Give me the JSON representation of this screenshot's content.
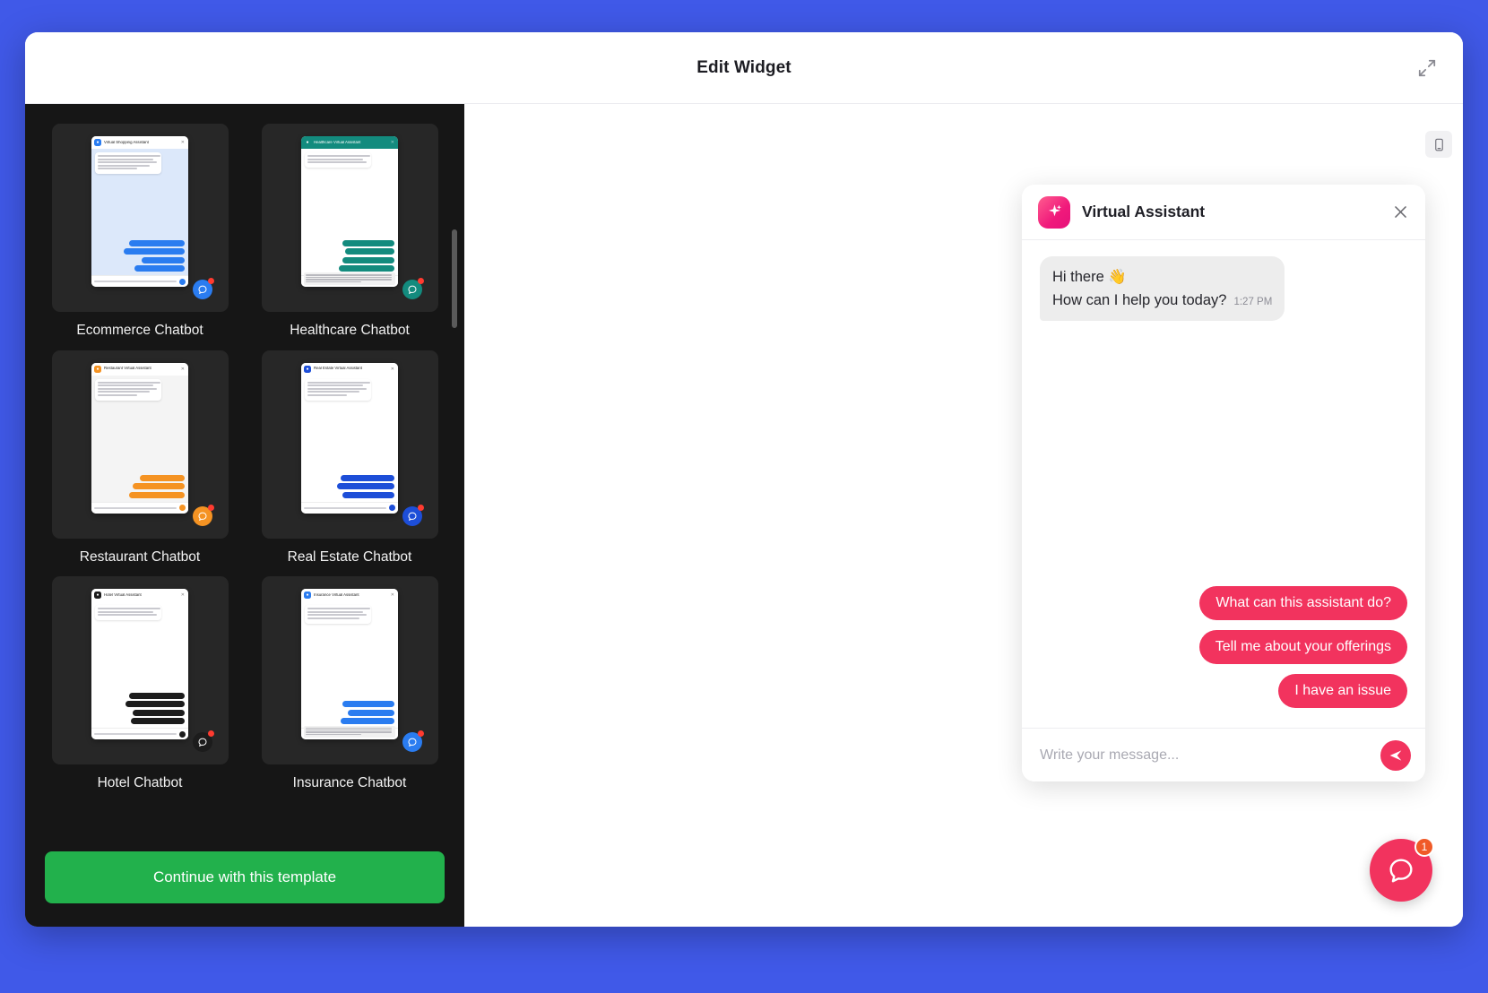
{
  "app": {
    "background_color": "#4059e8",
    "modal_title": "Edit Widget",
    "expand_icon": "expand-arrows-icon"
  },
  "sidebar": {
    "continue_button_label": "Continue with this template",
    "continue_button_color": "#22b14c",
    "templates": [
      {
        "label": "Ecommerce Chatbot",
        "window_title": "Virtual Shopping Assistant",
        "accent": "#2a7cf0",
        "header_bg": "#ffffff",
        "header_text": "#222222",
        "body_bg": "#dce8fa",
        "fab_icon": "chat-clock-icon",
        "reply_widths": [
          62,
          68,
          48,
          56
        ],
        "bot_lines": 5,
        "has_disclaimer": false
      },
      {
        "label": "Healthcare Chatbot",
        "window_title": "Healthcare Virtual Assistant",
        "accent": "#138b7e",
        "header_bg": "#138b7e",
        "header_text": "#ffffff",
        "body_bg": "#ffffff",
        "fab_icon": "chat-bubble-icon",
        "reply_widths": [
          58,
          55,
          58,
          62
        ],
        "bot_lines": 3,
        "has_disclaimer": true
      },
      {
        "label": "Restaurant Chatbot",
        "window_title": "Restaurant Virtual Assistant",
        "accent": "#f59323",
        "header_bg": "#ffffff",
        "header_text": "#222222",
        "body_bg": "#f4f4f4",
        "fab_icon": "utensils-icon",
        "reply_widths": [
          50,
          58,
          62
        ],
        "bot_lines": 5,
        "has_disclaimer": false
      },
      {
        "label": "Real Estate Chatbot",
        "window_title": "Real Estate Virtual Assistant",
        "accent": "#1d4ed8",
        "header_bg": "#ffffff",
        "header_text": "#222222",
        "body_bg": "#ffffff",
        "fab_icon": "chat-bubble-icon",
        "reply_widths": [
          60,
          64,
          58
        ],
        "bot_lines": 5,
        "has_disclaimer": false
      },
      {
        "label": "Hotel Chatbot",
        "window_title": "Hotel Virtual Assistant",
        "accent": "#1c1c1c",
        "header_bg": "#ffffff",
        "header_text": "#222222",
        "body_bg": "#ffffff",
        "fab_icon": "chat-bubble-icon",
        "reply_widths": [
          62,
          66,
          58,
          60
        ],
        "bot_lines": 3,
        "has_disclaimer": false
      },
      {
        "label": "Insurance Chatbot",
        "window_title": "Insurance Virtual Assistant",
        "accent": "#2a7cf0",
        "header_bg": "#ffffff",
        "header_text": "#222222",
        "body_bg": "#ffffff",
        "fab_icon": "chat-bubble-icon",
        "reply_widths": [
          58,
          52,
          60
        ],
        "bot_lines": 4,
        "has_disclaimer": true
      }
    ]
  },
  "preview": {
    "device_toggle_icon": "mobile-phone-icon",
    "widget": {
      "accent_color": "#f2335e",
      "bot_name": "Virtual Assistant",
      "avatar_icon": "sparkle-icon",
      "close_icon": "close-icon",
      "bot_message": {
        "line1": "Hi there 👋",
        "line2": "How can I help you today?",
        "time": "1:27 PM"
      },
      "quick_replies": [
        "What can this assistant do?",
        "Tell me about your offerings",
        "I have an issue"
      ],
      "input_placeholder": "Write your message...",
      "input_value": "",
      "send_icon": "send-plane-icon"
    },
    "fab": {
      "icon": "chat-bubble-icon",
      "badge_count": "1",
      "badge_color": "#f05a28"
    }
  }
}
